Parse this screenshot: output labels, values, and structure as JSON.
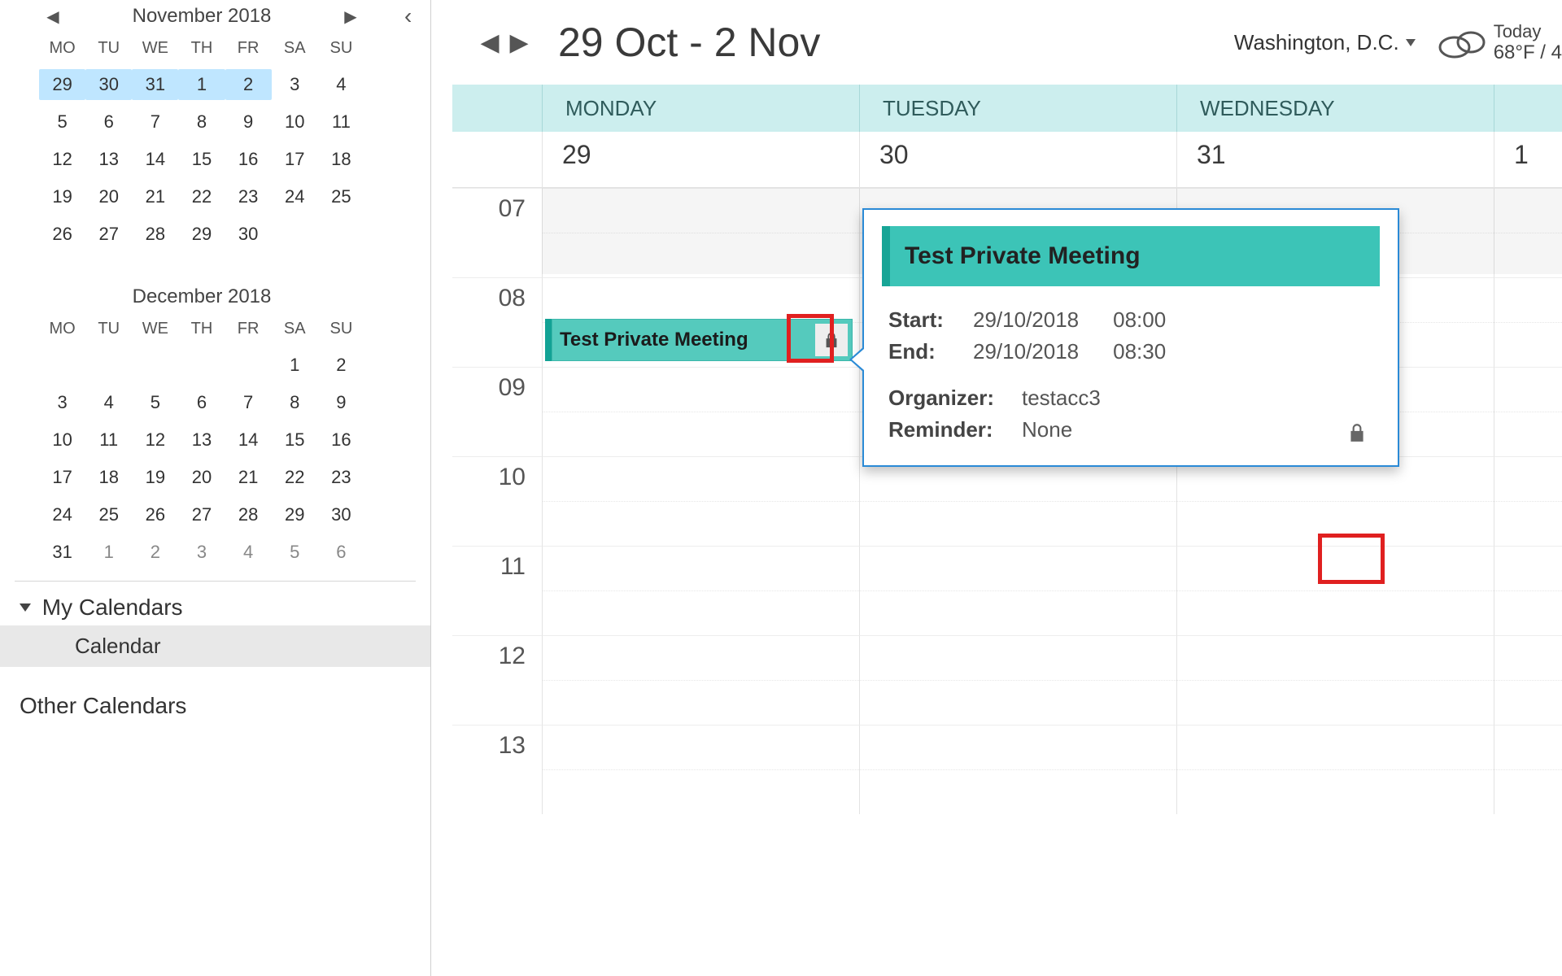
{
  "sidebar": {
    "months": [
      {
        "title": "November 2018",
        "show_nav": true,
        "dow": [
          "MO",
          "TU",
          "WE",
          "TH",
          "FR",
          "SA",
          "SU"
        ],
        "days": [
          {
            "n": 29,
            "sel": true
          },
          {
            "n": 30,
            "sel": true
          },
          {
            "n": 31,
            "sel": true
          },
          {
            "n": 1,
            "sel": true
          },
          {
            "n": 2,
            "sel": true
          },
          {
            "n": 3
          },
          {
            "n": 4
          },
          {
            "n": 5
          },
          {
            "n": 6
          },
          {
            "n": 7
          },
          {
            "n": 8
          },
          {
            "n": 9
          },
          {
            "n": 10
          },
          {
            "n": 11
          },
          {
            "n": 12
          },
          {
            "n": 13
          },
          {
            "n": 14
          },
          {
            "n": 15
          },
          {
            "n": 16
          },
          {
            "n": 17
          },
          {
            "n": 18
          },
          {
            "n": 19
          },
          {
            "n": 20
          },
          {
            "n": 21
          },
          {
            "n": 22
          },
          {
            "n": 23
          },
          {
            "n": 24
          },
          {
            "n": 25
          },
          {
            "n": 26
          },
          {
            "n": 27
          },
          {
            "n": 28
          },
          {
            "n": 29
          },
          {
            "n": 30
          }
        ]
      },
      {
        "title": "December 2018",
        "show_nav": false,
        "dow": [
          "MO",
          "TU",
          "WE",
          "TH",
          "FR",
          "SA",
          "SU"
        ],
        "days": [
          {
            "blank": true
          },
          {
            "blank": true
          },
          {
            "blank": true
          },
          {
            "blank": true
          },
          {
            "blank": true
          },
          {
            "n": 1
          },
          {
            "n": 2
          },
          {
            "n": 3
          },
          {
            "n": 4
          },
          {
            "n": 5
          },
          {
            "n": 6
          },
          {
            "n": 7
          },
          {
            "n": 8
          },
          {
            "n": 9
          },
          {
            "n": 10
          },
          {
            "n": 11
          },
          {
            "n": 12
          },
          {
            "n": 13
          },
          {
            "n": 14
          },
          {
            "n": 15
          },
          {
            "n": 16
          },
          {
            "n": 17
          },
          {
            "n": 18
          },
          {
            "n": 19
          },
          {
            "n": 20
          },
          {
            "n": 21
          },
          {
            "n": 22
          },
          {
            "n": 23
          },
          {
            "n": 24
          },
          {
            "n": 25
          },
          {
            "n": 26
          },
          {
            "n": 27
          },
          {
            "n": 28
          },
          {
            "n": 29
          },
          {
            "n": 30
          },
          {
            "n": 31
          },
          {
            "n": 1,
            "dim": true
          },
          {
            "n": 2,
            "dim": true
          },
          {
            "n": 3,
            "dim": true
          },
          {
            "n": 4,
            "dim": true
          },
          {
            "n": 5,
            "dim": true
          },
          {
            "n": 6,
            "dim": true
          }
        ]
      }
    ],
    "groups": {
      "my_calendars_label": "My Calendars",
      "calendar_item": "Calendar",
      "other_calendars_label": "Other Calendars"
    }
  },
  "header": {
    "range": "29 Oct - 2 Nov",
    "location": "Washington, D.C.",
    "today_label": "Today",
    "today_temp": "68°F / 4"
  },
  "grid": {
    "dow": [
      "MONDAY",
      "TUESDAY",
      "WEDNESDAY"
    ],
    "dates": [
      "29",
      "30",
      "31"
    ],
    "partial_date": "1",
    "hours": [
      "07",
      "08",
      "09",
      "10",
      "11",
      "12",
      "13"
    ]
  },
  "event": {
    "title": "Test Private Meeting"
  },
  "popup": {
    "title": "Test Private Meeting",
    "labels": {
      "start": "Start:",
      "end": "End:",
      "organizer": "Organizer:",
      "reminder": "Reminder:"
    },
    "start_date": "29/10/2018",
    "start_time": "08:00",
    "end_date": "29/10/2018",
    "end_time": "08:30",
    "organizer": "testacc3",
    "reminder": "None"
  }
}
